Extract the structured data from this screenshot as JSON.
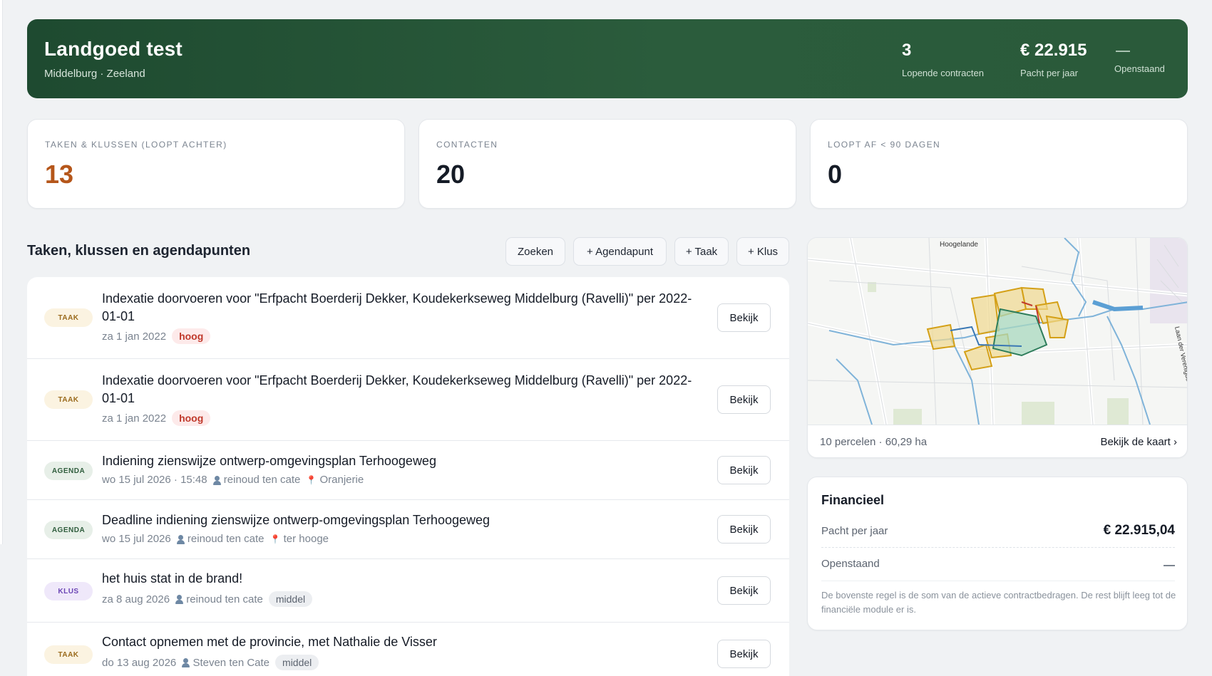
{
  "hero": {
    "title": "Landgoed test",
    "subtitle": "Middelburg · Zeeland",
    "stats": [
      {
        "value": "3",
        "label": "Lopende contracten"
      },
      {
        "value": "€ 22.915",
        "label": "Pacht per jaar"
      },
      {
        "value": "—",
        "label": "Openstaand"
      }
    ]
  },
  "summary_cards": [
    {
      "label": "TAKEN & KLUSSEN (LOOPT ACHTER)",
      "value": "13",
      "accent": "#b5561a"
    },
    {
      "label": "CONTACTEN",
      "value": "20"
    },
    {
      "label": "LOOPT AF < 90 DAGEN",
      "value": "0"
    }
  ],
  "tasks_section": {
    "title": "Taken, klussen en agendapunten",
    "buttons": {
      "search": "Zoeken",
      "add_agenda": "+ Agendapunt",
      "add_task": "+ Taak",
      "add_job": "+ Klus"
    },
    "view_label": "Bekijk",
    "items": [
      {
        "type": "TAAK",
        "title": "Indexatie doorvoeren voor \"Erfpacht Boerderij Dekker, Koudekerkseweg Middelburg (Ravelli)\" per 2022-01-01",
        "date": "za 1 jan 2022",
        "priority": "hoog"
      },
      {
        "type": "TAAK",
        "title": "Indexatie doorvoeren voor \"Erfpacht Boerderij Dekker, Koudekerkseweg Middelburg (Ravelli)\" per 2022-01-01",
        "date": "za 1 jan 2022",
        "priority": "hoog"
      },
      {
        "type": "AGENDA",
        "title": "Indiening zienswijze ontwerp-omgevingsplan Terhoogeweg",
        "date": "wo 15 jul 2026 · 15:48",
        "person": "reinoud ten cate",
        "location": "Oranjerie"
      },
      {
        "type": "AGENDA",
        "title": "Deadline indiening zienswijze ontwerp-omgevingsplan Terhoogeweg",
        "date": "wo 15 jul 2026",
        "person": "reinoud ten cate",
        "location": "ter hooge"
      },
      {
        "type": "KLUS",
        "title": "het huis stat in de brand!",
        "date": "za 8 aug 2026",
        "person": "reinoud ten cate",
        "priority": "middel"
      },
      {
        "type": "TAAK",
        "title": "Contact opnemen met de provincie, met Nathalie de Visser",
        "date": "do 13 aug 2026",
        "person": "Steven ten Cate",
        "priority": "middel"
      }
    ]
  },
  "map": {
    "place_label": "Hoogelande",
    "road_label": "Laan der Verenigde Naties",
    "summary": "10 percelen · 60,29 ha",
    "link": "Bekijk de kaart ›"
  },
  "finance": {
    "title": "Financieel",
    "rows": [
      {
        "label": "Pacht per jaar",
        "value": "€ 22.915,04"
      },
      {
        "label": "Openstaand",
        "value": "—"
      }
    ],
    "note": "De bovenste regel is de som van de actieve contractbedragen. De rest blijft leeg tot de financiële module er is."
  },
  "colors": {
    "hero_green": "#24523a",
    "priority_high": "#c0392b",
    "badge_taak": "#fbf3e1",
    "badge_agenda": "#e7efe8",
    "badge_klus": "#efe8fa"
  }
}
